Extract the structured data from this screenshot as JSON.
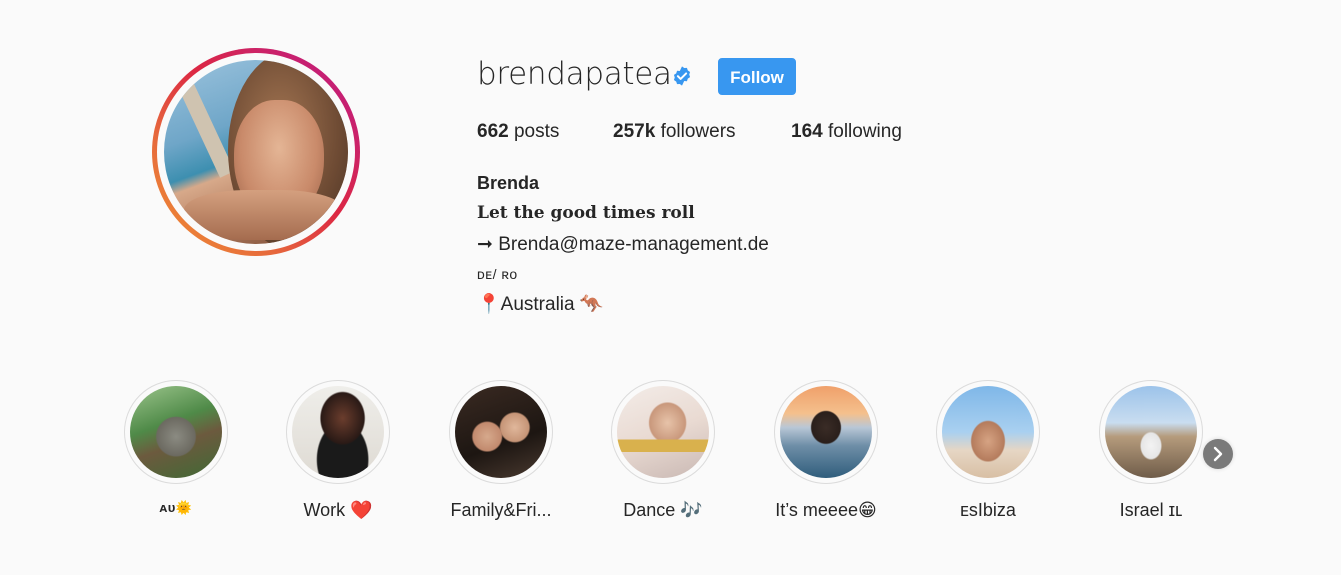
{
  "profile": {
    "username": "brendapatea",
    "verified": true,
    "follow_label": "Follow",
    "accent_color": "#3897f0",
    "verified_color": "#3897f0"
  },
  "stats": {
    "posts_count": "662",
    "posts_label": "posts",
    "followers_count": "257k",
    "followers_label": "followers",
    "following_count": "164",
    "following_label": "following"
  },
  "bio": {
    "name": "Brenda",
    "motto": "Let the good times roll",
    "email_line": "➞ Brenda@maze-management.de",
    "languages": "ᴅᴇ/ ʀᴏ",
    "location": "📍Australia 🦘"
  },
  "highlights": [
    {
      "label": "ᴀᴜ🌞",
      "icon": "koala-photo"
    },
    {
      "label": "Work ❤️",
      "icon": "red-carpet-photo"
    },
    {
      "label": "Family&Fri...",
      "icon": "friends-photo"
    },
    {
      "label": "Dance 🎶",
      "icon": "selfie-photo"
    },
    {
      "label": "It’s meeee😁",
      "icon": "sunset-city-photo"
    },
    {
      "label": "ᴇsIbiza",
      "icon": "ibiza-photo"
    },
    {
      "label": "Israel ɪʟ",
      "icon": "israel-photo"
    }
  ]
}
